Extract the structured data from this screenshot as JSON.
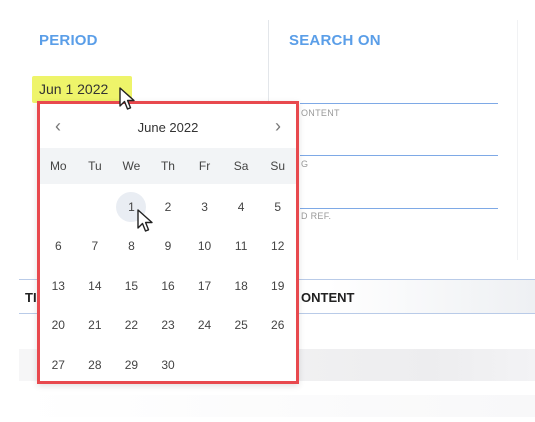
{
  "period": {
    "heading": "PERIOD",
    "selected_date": "Jun 1 2022"
  },
  "search": {
    "heading": "SEARCH ON",
    "fields": [
      {
        "label": "ONTENT"
      },
      {
        "label": "G"
      },
      {
        "label": "D REF."
      }
    ]
  },
  "table": {
    "header_left": "TI",
    "header_right": "ONTENT"
  },
  "calendar": {
    "month_title": "June 2022",
    "prev_icon": "‹",
    "next_icon": "›",
    "weekdays": [
      "Mo",
      "Tu",
      "We",
      "Th",
      "Fr",
      "Sa",
      "Su"
    ],
    "days": [
      "1",
      "2",
      "3",
      "4",
      "5",
      "6",
      "7",
      "8",
      "9",
      "10",
      "11",
      "12",
      "13",
      "14",
      "15",
      "16",
      "17",
      "18",
      "19",
      "20",
      "21",
      "22",
      "23",
      "24",
      "25",
      "26",
      "27",
      "28",
      "29",
      "30"
    ],
    "selected_day": "1"
  },
  "colors": {
    "heading": "#5a9ee8",
    "highlight": "#eef46a",
    "calendar_border": "#e8494e"
  },
  "icons": [
    "cursor-arrow-icon",
    "chevron-left-icon",
    "chevron-right-icon",
    "hand-pointer-icon"
  ]
}
